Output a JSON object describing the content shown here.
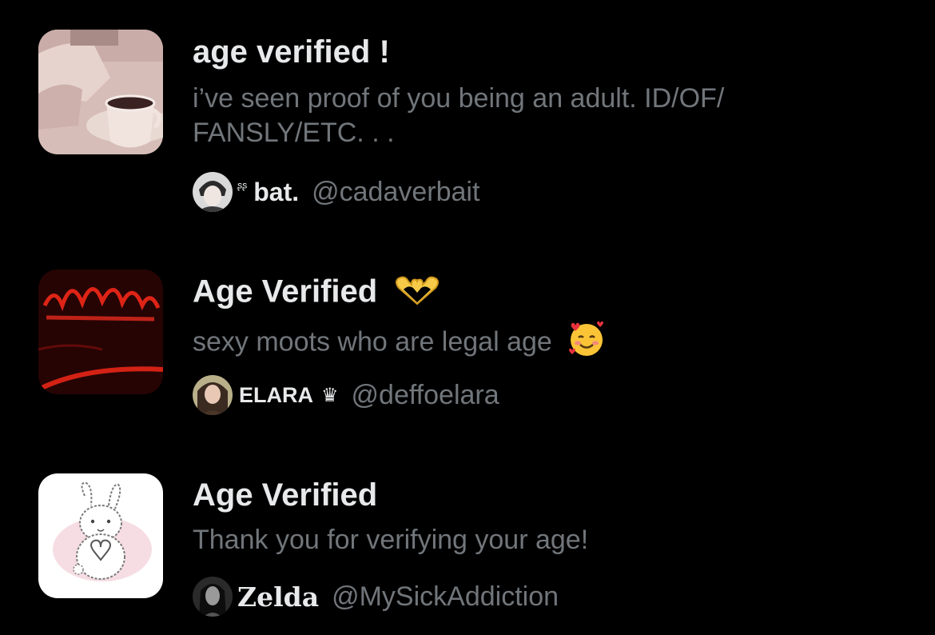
{
  "lists": [
    {
      "title": "age verified !",
      "description_line1": "i’ve seen proof of you being an adult. ID/OF/",
      "description_line2": "FANSLY/ETC. . .",
      "owner_prefix": "ᶳᶳ",
      "owner_name": "bat.",
      "owner_handle": "@cadaverbait"
    },
    {
      "title": "Age Verified",
      "title_emoji": "heart-hands",
      "description": "sexy moots who are legal age",
      "description_emoji": "smiling-face-with-hearts",
      "owner_name": "ELARA",
      "owner_badge": "♛",
      "owner_handle": "@deffoelara"
    },
    {
      "title": "Age Verified",
      "description": "Thank you for verifying your age!",
      "owner_name": "Zelda",
      "owner_handle": "@MySickAddiction"
    }
  ],
  "colors": {
    "background": "#000000",
    "primary_text": "#e7e9ea",
    "secondary_text": "#71767b"
  }
}
